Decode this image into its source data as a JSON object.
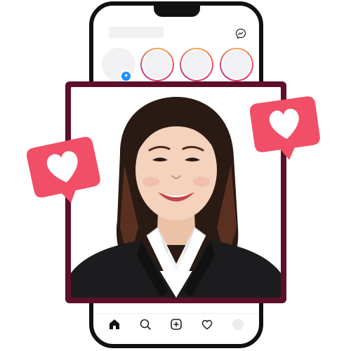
{
  "colors": {
    "phone_frame": "#111111",
    "card_border": "#5e0f2a",
    "heart_bubble": "#f04f67",
    "heart": "#ffffff",
    "story_placeholder": "#f1f1f3",
    "add_badge": "#1e90ff"
  },
  "header": {
    "icons": [
      "messenger-icon"
    ]
  },
  "stories": {
    "own_story": {
      "badge_icon": "plus-icon"
    },
    "rings": 3
  },
  "bottom_nav": {
    "items": [
      "home-icon",
      "search-icon",
      "new-post-icon",
      "activity-heart-icon",
      "profile-avatar"
    ]
  },
  "post": {
    "image": "portrait-photo"
  },
  "reactions": [
    "like-heart-badge",
    "like-heart-badge"
  ]
}
